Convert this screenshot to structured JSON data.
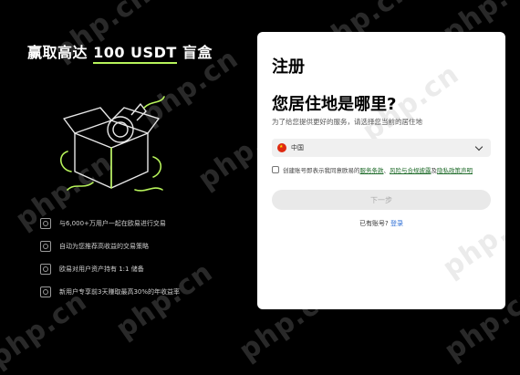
{
  "promo": {
    "headline_pre": "赢取高达 ",
    "headline_highlight": "100 USDT",
    "headline_post": " 盲盒",
    "accent_color": "#b7f35b",
    "features": [
      {
        "icon": "users-icon",
        "text": "与6,000+万用户一起在欧易进行交易"
      },
      {
        "icon": "chart-icon",
        "text": "自动为您推荐高收益的交易策略"
      },
      {
        "icon": "shield-icon",
        "text": "欧易对用户资产持有 1:1 储备"
      },
      {
        "icon": "percent-icon",
        "text": "新用户专享前3天赚取最高30%的年收益率"
      }
    ]
  },
  "register": {
    "title": "注册",
    "question": "您居住地是哪里?",
    "subtitle": "为了给您提供更好的服务，请选择您当前的居住地",
    "country": "中国",
    "agree_text": "创建账号即表示我同意欧易的",
    "terms_link": "服务条款",
    "sep1": "、",
    "risk_link": "风险与合规披露",
    "sep2": "及",
    "privacy_link": "隐私政策声明",
    "next_label": "下一步",
    "have_account": "已有账号?",
    "login_link": "登录"
  },
  "watermark": "php.cn"
}
